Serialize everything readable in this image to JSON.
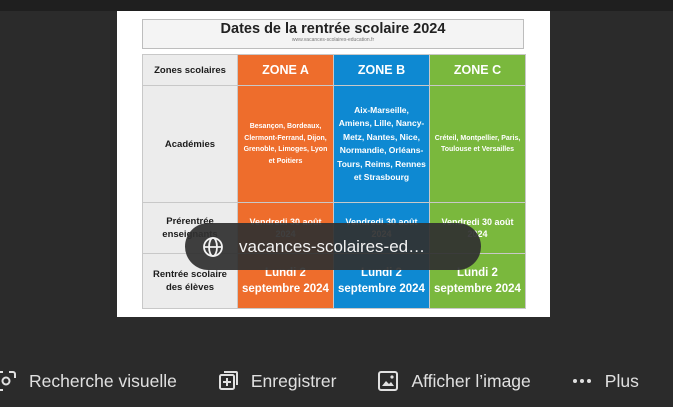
{
  "preview": {
    "title": "Dates de la rentrée scolaire 2024",
    "source_url": "www.vacances-scolaires-education.fr",
    "table": {
      "row_labels": [
        "Zones scolaires",
        "Académies",
        "Prérentrée enseignants",
        "Rentrée scolaire des élèves"
      ],
      "zones": [
        {
          "name": "ZONE A",
          "color": "#ee6d2c",
          "academies": "Besançon, Bordeaux, Clermont-Ferrand, Dijon, Grenoble, Limoges, Lyon et Poitiers",
          "prerentree": "Vendredi 30 août 2024",
          "rentree": "Lundi 2 septembre 2024"
        },
        {
          "name": "ZONE B",
          "color": "#0e89d2",
          "academies": "Aix-Marseille, Amiens, Lille, Nancy-Metz, Nantes, Nice, Normandie, Orléans-Tours, Reims, Rennes et Strasbourg",
          "prerentree": "Vendredi 30 août 2024",
          "rentree": "Lundi 2 septembre 2024"
        },
        {
          "name": "ZONE C",
          "color": "#7ab83d",
          "academies": "Créteil, Montpellier, Paris, Toulouse et Versailles",
          "prerentree": "Vendredi 30 août 2024",
          "rentree": "Lundi 2 septembre 2024"
        }
      ]
    }
  },
  "source_chip": {
    "label": "vacances-scolaires-ed…",
    "icon": "globe-icon"
  },
  "actions": [
    {
      "label": "Recherche visuelle",
      "icon": "lens-icon"
    },
    {
      "label": "Enregistrer",
      "icon": "bookmark-add-icon"
    },
    {
      "label": "Afficher l’image",
      "icon": "image-icon"
    },
    {
      "label": "Plus",
      "icon": "more-horiz-icon"
    }
  ]
}
